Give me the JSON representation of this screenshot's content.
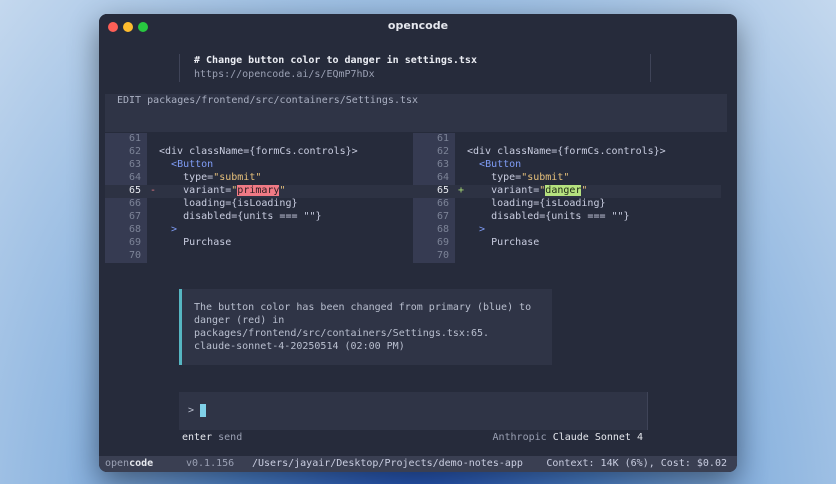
{
  "window": {
    "title": "opencode"
  },
  "prompt": {
    "text": "# Change button color to danger in settings.tsx",
    "link": "https://opencode.ai/s/EQmP7hDx"
  },
  "edit": {
    "header": "EDIT packages/frontend/src/containers/Settings.tsx",
    "left": {
      "line_numbers": [
        "61",
        "62",
        "63",
        "64",
        "65",
        "66",
        "67",
        "68",
        "69",
        "70"
      ],
      "changed_marker": "-",
      "line62": "<div className={formCs.controls}>",
      "line63": "<Button",
      "line64_attr": "type=",
      "line64_val": "\"submit\"",
      "line65_attr": "variant=",
      "line65_q1": "\"",
      "line65_word": "primary",
      "line65_q2": "\"",
      "line66": "loading={isLoading}",
      "line67": "disabled={units === \"\"}",
      "line68": ">",
      "line69": "Purchase"
    },
    "right": {
      "line_numbers": [
        "61",
        "62",
        "63",
        "64",
        "65",
        "66",
        "67",
        "68",
        "69",
        "70"
      ],
      "changed_marker": "+",
      "line62": "<div className={formCs.controls}>",
      "line63": "<Button",
      "line64_attr": "type=",
      "line64_val": "\"submit\"",
      "line65_attr": "variant=",
      "line65_q1": "\"",
      "line65_word": "danger",
      "line65_q2": "\"",
      "line66": "loading={isLoading}",
      "line67": "disabled={units === \"\"}",
      "line68": ">",
      "line69": "Purchase"
    }
  },
  "message": {
    "line1": "The button color has been changed from primary (blue) to",
    "line2": "danger (red) in",
    "line3": "packages/frontend/src/containers/Settings.tsx:65.",
    "line4": "claude-sonnet-4-20250514 (02:00 PM)"
  },
  "input": {
    "prompt_symbol": ">"
  },
  "hints": {
    "left_key": "enter",
    "left_action": "send",
    "right_provider": "Anthropic",
    "right_model": "Claude Sonnet 4"
  },
  "statusbar": {
    "app_open": "open",
    "app_code": "code",
    "version": "v0.1.156",
    "path": "/Users/jayair/Desktop/Projects/demo-notes-app",
    "context": "Context: 14K (6%), Cost: $0.02"
  },
  "colors": {
    "window_bg": "#262b3b",
    "accent_cyan": "#56b6c2",
    "removed_highlight": "#f07a85",
    "added_highlight": "#b6e27f"
  }
}
